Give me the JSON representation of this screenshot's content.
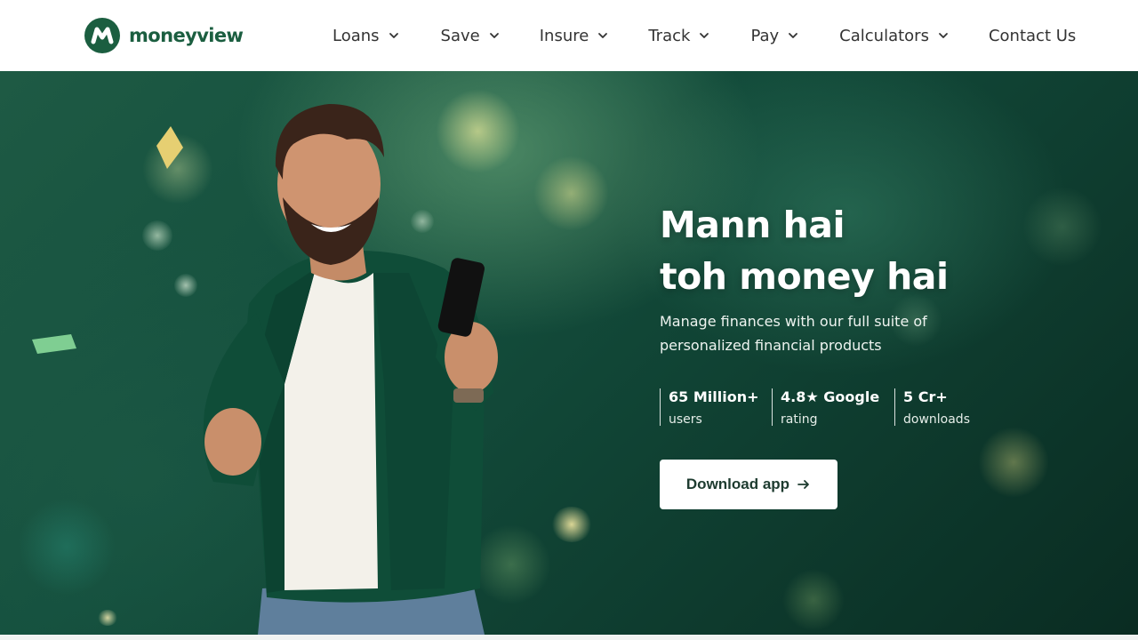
{
  "brand": {
    "name": "moneyview",
    "color": "#1b5e40"
  },
  "nav": {
    "items": [
      {
        "label": "Loans",
        "has_dropdown": true
      },
      {
        "label": "Save",
        "has_dropdown": true
      },
      {
        "label": "Insure",
        "has_dropdown": true
      },
      {
        "label": "Track",
        "has_dropdown": true
      },
      {
        "label": "Pay",
        "has_dropdown": true
      },
      {
        "label": "Calculators",
        "has_dropdown": true
      },
      {
        "label": "Contact Us",
        "has_dropdown": false
      }
    ]
  },
  "hero": {
    "headline_line1": "Mann hai",
    "headline_line2": "toh money hai",
    "subtitle": "Manage finances with our full suite of personalized financial products",
    "stats": [
      {
        "value": "65 Million+",
        "label": "users"
      },
      {
        "value": "4.8★ Google",
        "label": "rating"
      },
      {
        "value": "5 Cr+",
        "label": "downloads"
      }
    ],
    "cta_label": "Download app",
    "cta_icon": "arrow-right-icon",
    "background_color": "#14503e"
  }
}
